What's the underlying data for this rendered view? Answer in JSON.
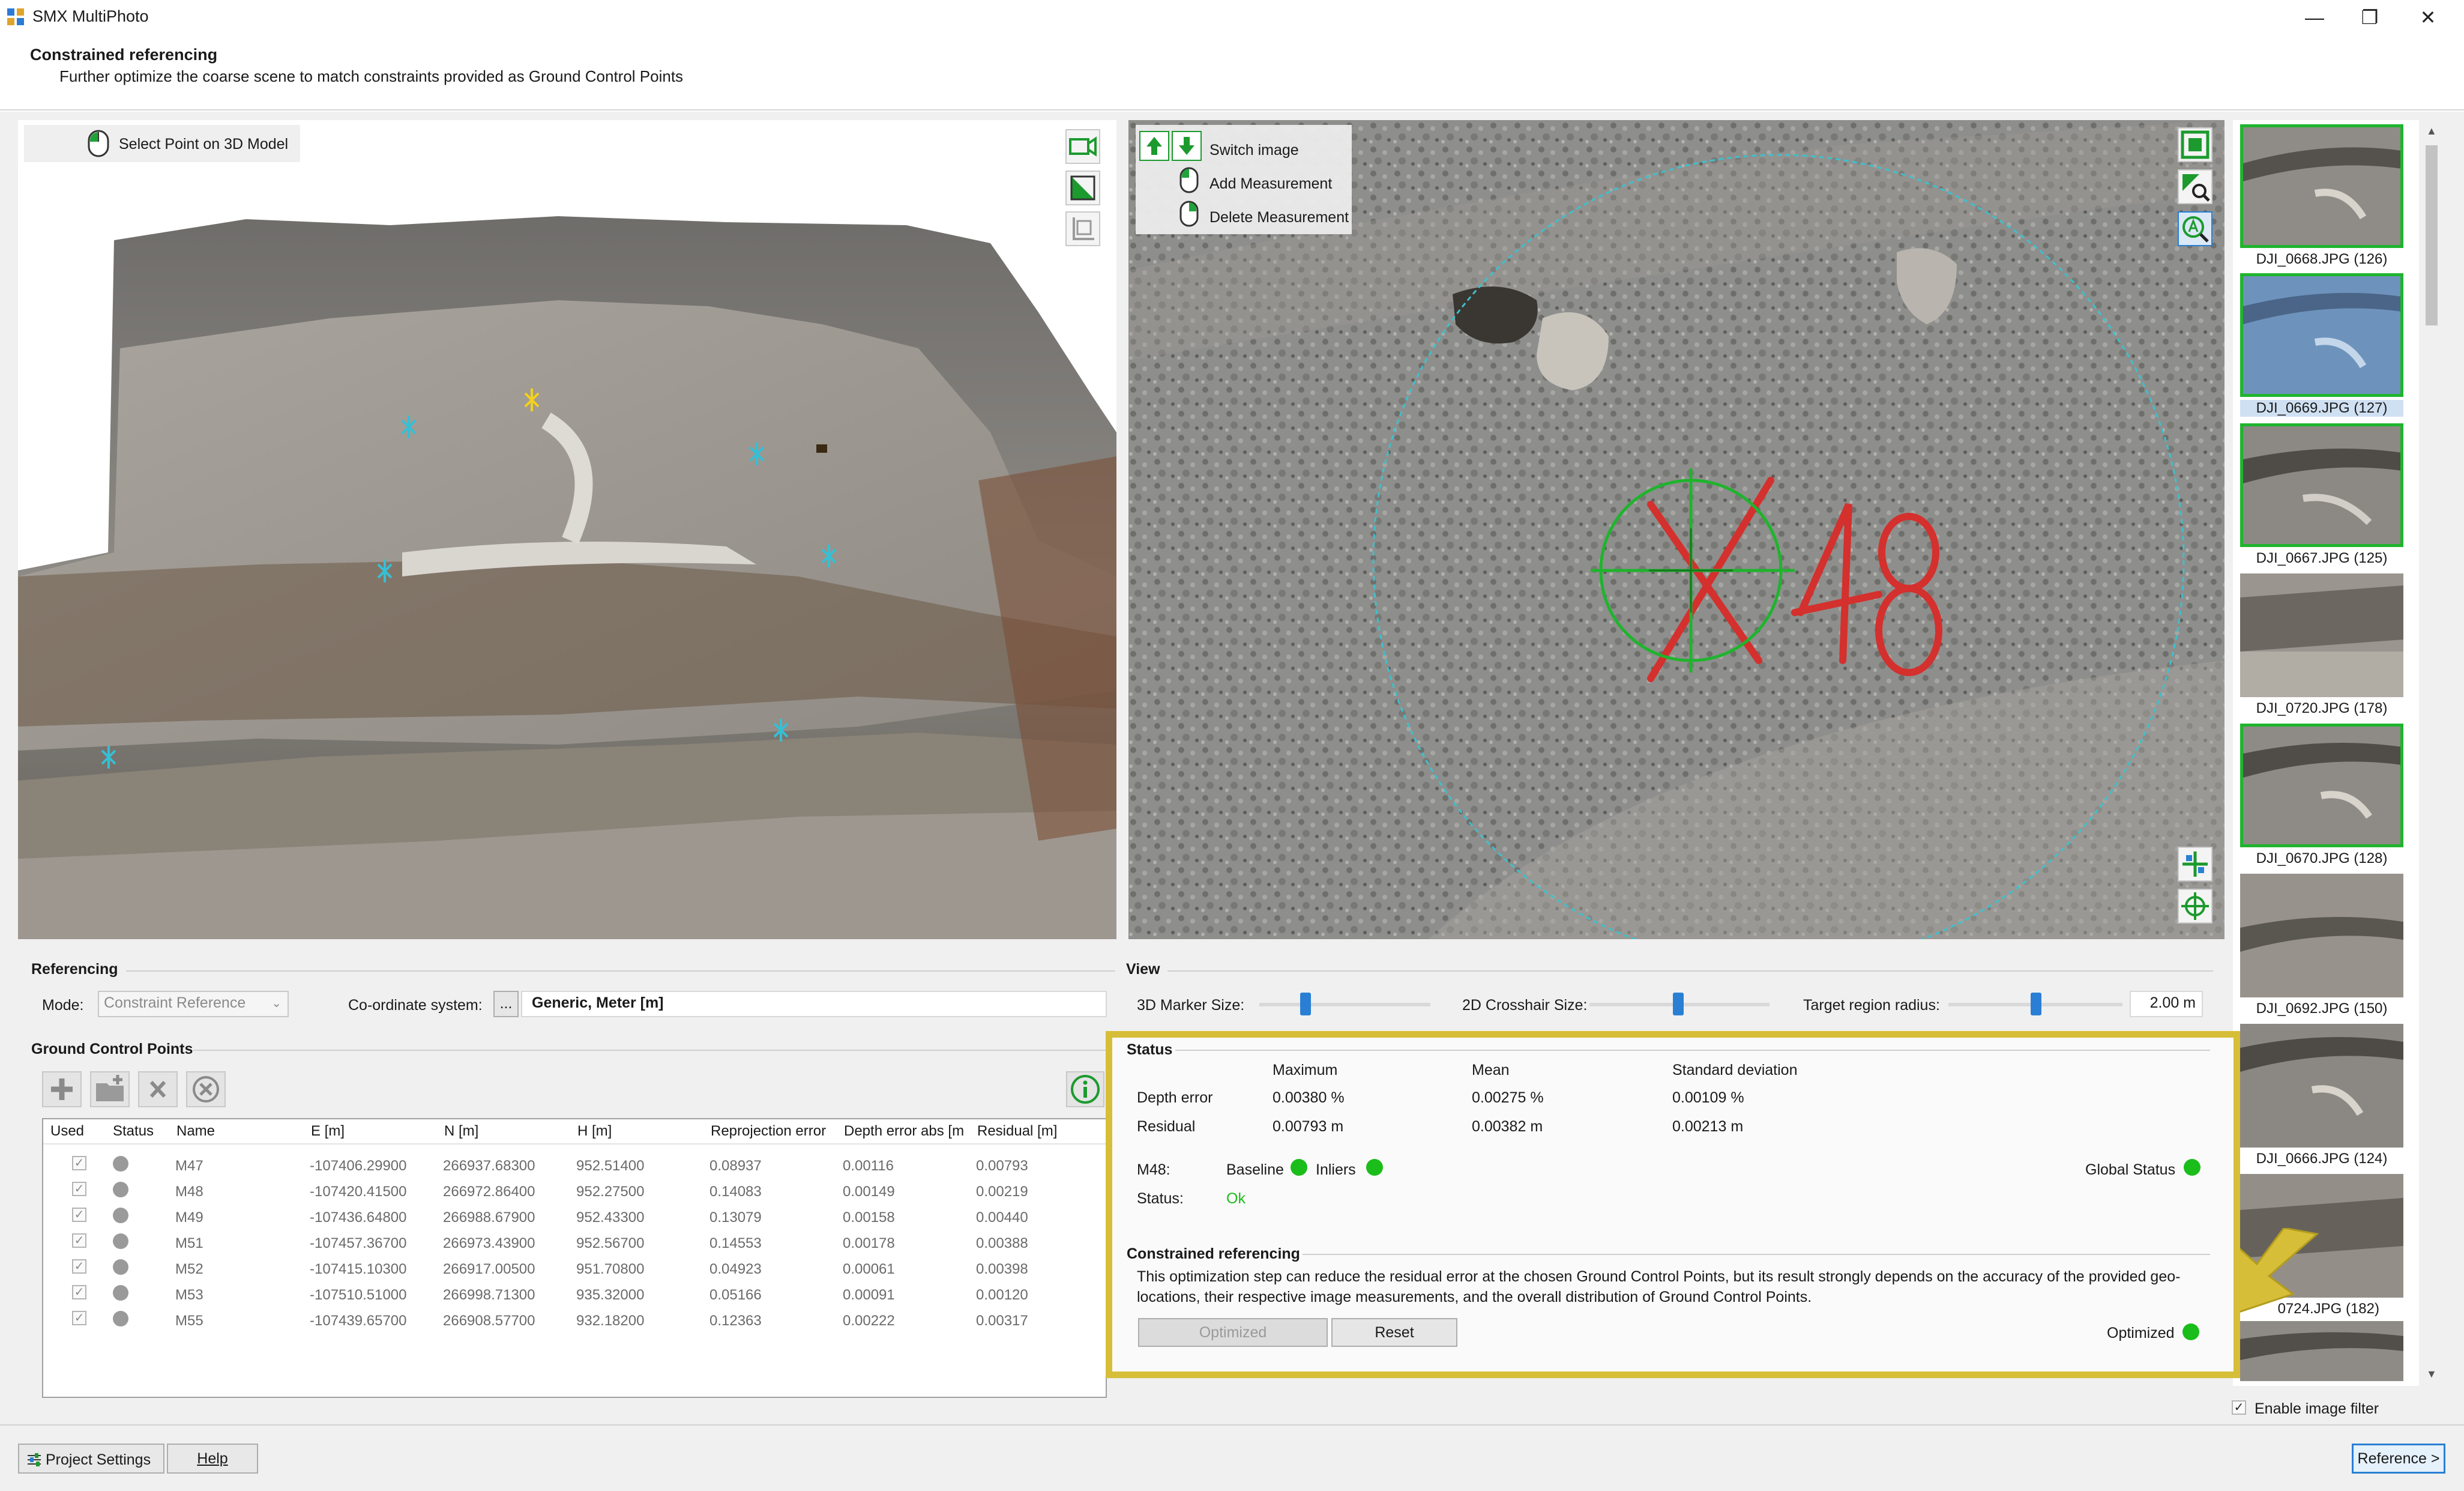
{
  "window": {
    "title": "SMX MultiPhoto",
    "minimize": "—",
    "restore": "❐",
    "close": "✕"
  },
  "header": {
    "title": "Constrained referencing",
    "subtitle": "Further optimize the coarse scene to match constraints provided as Ground Control Points"
  },
  "view3d": {
    "select_point_label": "Select Point on 3D Model"
  },
  "image_view": {
    "switch_image": "Switch image",
    "add_measurement": "Add Measurement",
    "delete_measurement": "Delete Measurement",
    "marker_label": "M48"
  },
  "referencing": {
    "title": "Referencing",
    "mode_label": "Mode:",
    "mode_value": "Constraint Reference",
    "coord_label": "Co-ordinate system:",
    "coord_button": "...",
    "coord_value": "Generic, Meter [m]"
  },
  "view": {
    "title": "View",
    "marker_size_label": "3D Marker Size:",
    "crosshair_label": "2D Crosshair Size:",
    "target_radius_label": "Target region radius:",
    "target_radius_value": "2.00 m"
  },
  "gcp": {
    "title": "Ground Control Points",
    "columns": [
      "Used",
      "Status",
      "Name",
      "E [m]",
      "N [m]",
      "H [m]",
      "Reprojection error",
      "Depth error abs [m",
      "Residual [m]"
    ],
    "rows": [
      {
        "name": "M47",
        "e": "-107406.29900",
        "n": "266937.68300",
        "h": "952.51400",
        "reproj": "0.08937",
        "depth": "0.00116",
        "residual": "0.00793"
      },
      {
        "name": "M48",
        "e": "-107420.41500",
        "n": "266972.86400",
        "h": "952.27500",
        "reproj": "0.14083",
        "depth": "0.00149",
        "residual": "0.00219"
      },
      {
        "name": "M49",
        "e": "-107436.64800",
        "n": "266988.67900",
        "h": "952.43300",
        "reproj": "0.13079",
        "depth": "0.00158",
        "residual": "0.00440"
      },
      {
        "name": "M51",
        "e": "-107457.36700",
        "n": "266973.43900",
        "h": "952.56700",
        "reproj": "0.14553",
        "depth": "0.00178",
        "residual": "0.00388"
      },
      {
        "name": "M52",
        "e": "-107415.10300",
        "n": "266917.00500",
        "h": "951.70800",
        "reproj": "0.04923",
        "depth": "0.00061",
        "residual": "0.00398"
      },
      {
        "name": "M53",
        "e": "-107510.51000",
        "n": "266998.71300",
        "h": "935.32000",
        "reproj": "0.05166",
        "depth": "0.00091",
        "residual": "0.00120"
      },
      {
        "name": "M55",
        "e": "-107439.65700",
        "n": "266908.57700",
        "h": "932.18200",
        "reproj": "0.12363",
        "depth": "0.00222",
        "residual": "0.00317"
      }
    ]
  },
  "status": {
    "title": "Status",
    "col_max": "Maximum",
    "col_mean": "Mean",
    "col_std": "Standard deviation",
    "depth_label": "Depth error",
    "depth_max": "0.00380 %",
    "depth_mean": "0.00275 %",
    "depth_std": "0.00109 %",
    "residual_label": "Residual",
    "residual_max": "0.00793 m",
    "residual_mean": "0.00382 m",
    "residual_std": "0.00213 m",
    "marker": "M48:",
    "baseline": "Baseline",
    "inliers": "Inliers",
    "global_status": "Global Status",
    "status_label": "Status:",
    "status_value": "Ok"
  },
  "constrained": {
    "title": "Constrained referencing",
    "desc1": "This optimization step can reduce the residual error at the chosen Ground Control Points, but its result strongly depends on the accuracy of the provided geo-",
    "desc2": "locations, their respective image measurements, and the overall distribution of Ground Control Points.",
    "optimized_button": "Optimized",
    "reset_button": "Reset",
    "optimized_status": "Optimized"
  },
  "thumbnails": [
    {
      "label": "DJI_0668.JPG (126)"
    },
    {
      "label": "DJI_0669.JPG (127)"
    },
    {
      "label": "DJI_0667.JPG (125)"
    },
    {
      "label": "DJI_0720.JPG (178)"
    },
    {
      "label": "DJI_0670.JPG (128)"
    },
    {
      "label": "DJI_0692.JPG (150)"
    },
    {
      "label": "DJI_0666.JPG (124)"
    },
    {
      "label": "0724.JPG (182)"
    }
  ],
  "image_filter": {
    "label": "Enable image filter",
    "check": "✓"
  },
  "footer": {
    "project_settings": "Project Settings",
    "help": "Help",
    "reference": "Reference >"
  },
  "colors": {
    "accent": "#2a7fd4",
    "highlight": "#d7be38",
    "ok": "#1bbd1b"
  }
}
